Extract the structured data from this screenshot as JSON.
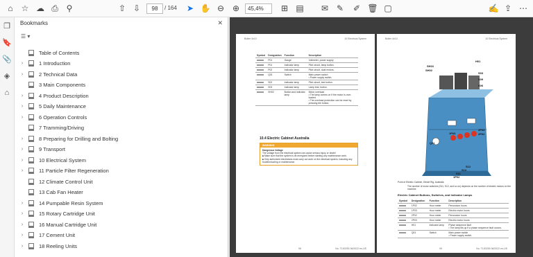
{
  "toolbar": {
    "page_current": "98",
    "page_total": "/ 164",
    "zoom": "45,4%"
  },
  "bookmarks": {
    "title": "Bookmarks",
    "items": [
      {
        "label": "Table of Contents",
        "expandable": false
      },
      {
        "label": "1 Introduction",
        "expandable": true
      },
      {
        "label": "2 Technical Data",
        "expandable": true
      },
      {
        "label": "3 Main Components",
        "expandable": false
      },
      {
        "label": "4 Product Description",
        "expandable": true
      },
      {
        "label": "5 Daily Maintenance",
        "expandable": true
      },
      {
        "label": "6 Operation Controls",
        "expandable": true
      },
      {
        "label": "7 Tramming/Driving",
        "expandable": false
      },
      {
        "label": "8 Preparing for Drilling and Bolting",
        "expandable": true
      },
      {
        "label": "9 Transport",
        "expandable": true
      },
      {
        "label": "10 Electrical System",
        "expandable": true
      },
      {
        "label": "11 Particle Filter Regeneration",
        "expandable": true
      },
      {
        "label": "12 Climate Control Unit",
        "expandable": false
      },
      {
        "label": "13 Cab Fan Heater",
        "expandable": false
      },
      {
        "label": "14 Pumpable Resin System",
        "expandable": true
      },
      {
        "label": "15 Rotary Cartridge Unit",
        "expandable": true
      },
      {
        "label": "16 Manual Cartridge Unit",
        "expandable": true
      },
      {
        "label": "17 Cement Unit",
        "expandable": true
      },
      {
        "label": "18 Reeling Units",
        "expandable": true
      }
    ]
  },
  "left_page": {
    "header_left": "Bolter 4x10",
    "header_right": "10 Electrical System",
    "table_headers": [
      "Symbol",
      "Designation",
      "Function",
      "Description"
    ],
    "rows": [
      {
        "designation": "P01",
        "function": "Gauge",
        "description": "Voltmeter, power supply"
      },
      {
        "designation": "P01",
        "function": "Indicator lamp",
        "description": "Pilot circuit, lamp button."
      },
      {
        "designation": "P02",
        "function": "Indicator lamp",
        "description": "Pilot circuit, dual motors."
      },
      {
        "designation": "Q01",
        "function": "Switch",
        "description": "Main power switch\n• Power supply switch."
      },
      {
        "designation": "S02",
        "function": "Indicator lamp",
        "description": "Pilot circuit, test button."
      },
      {
        "designation": "S03",
        "function": "Indicator lamp",
        "description": "Lamp test, button."
      },
      {
        "designation": "SH02",
        "function": "Button and indicator lamp",
        "description": "Motor overload\n• The lamp comes on if the motor is over-loaded.\n• The overload protection can be reset by pressing the button."
      }
    ],
    "section_title": "10.4  Electric Cabinet Australia",
    "warning_label": "WARNING",
    "warning_title": "Dangerous Voltage",
    "warning_lines": [
      "The voltage from the electrical system can cause serious injury or death!",
      "■ Make sure that the system is de-energized before starting any maintenance work.",
      "■ Only authorized electricians must carry out work on the electrical system, including any troubleshooting or maintenance."
    ],
    "page_num": "96",
    "footer_right": "No. T100253 06/2022 en-US"
  },
  "right_page": {
    "header_left": "Bolter 4x10",
    "header_right": "10 Electrical System",
    "figure_caption": "Point of Electric Cabinet, Diesel Rig, Australia",
    "note": "The number of motor switches (S11, S12, and so on) depends on the number of electric motors on the machine.",
    "section_title": "Electric Cabinet Buttons, Switches, and Indicator Lamps",
    "table_headers": [
      "Symbol",
      "Designation",
      "Function",
      "Description"
    ],
    "rows": [
      {
        "designation": "1P02",
        "function": "Hour meter",
        "description": "Percussion hours"
      },
      {
        "designation": "1P03",
        "function": "Hour meter",
        "description": "Electric motor hours"
      },
      {
        "designation": "2P02",
        "function": "Hour meter",
        "description": "Percussion hours"
      },
      {
        "designation": "2P03",
        "function": "Hour meter",
        "description": "Electric motor hours"
      },
      {
        "designation": "H01",
        "function": "Indicator lamp",
        "description": "Phase sequence fault\n• The lamp lits up if a phase sequence fault occurs."
      },
      {
        "designation": "Q01",
        "function": "Switch",
        "description": "Main power switch\n• Power supply switch."
      }
    ],
    "callouts": [
      "H01",
      "SH16",
      "SH02",
      "S03",
      "S09",
      "S06",
      "1P03",
      "2P03",
      "2P02",
      "Q01",
      "S12",
      "S13",
      "S11",
      "1P02"
    ],
    "page_num": "99",
    "footer_right": "No. T100253 06/2022 en-US"
  }
}
